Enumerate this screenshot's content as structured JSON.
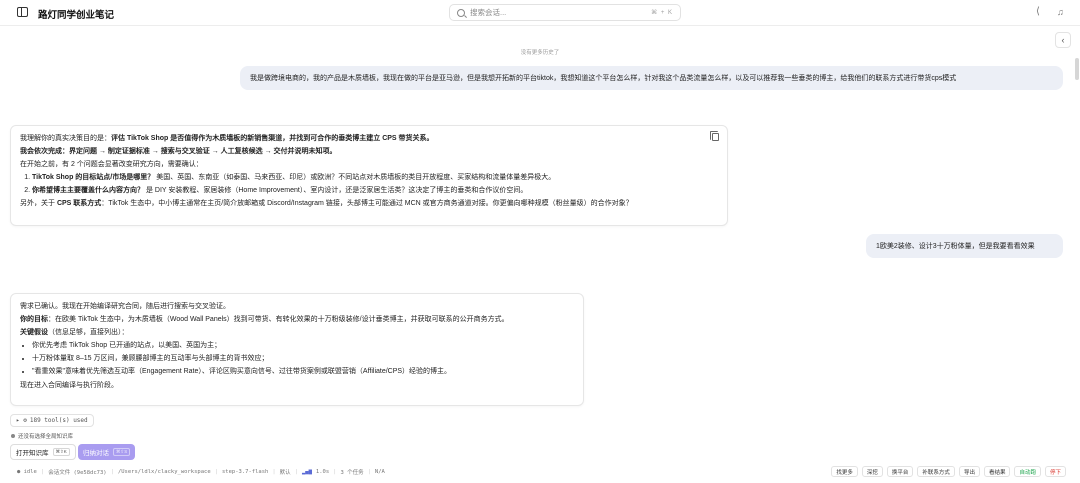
{
  "header": {
    "app_title": "路灯同学创业笔记",
    "search_placeholder": "搜索会话...",
    "search_shortcut": "⌘ + K"
  },
  "thread": {
    "no_history": "没有更多历史了",
    "msg1_user": "我是做跨境电商的，我的产品是木质墙板，我现在做的平台是亚马逊，但是我想开拓新的平台tiktok，我想知道这个平台怎么样，针对我这个品类流量怎么样，以及可以推荐我一些垂类的博主，给我他们的联系方式进行带货cps模式",
    "ai1": {
      "l1_a": "我理解你的真实决策目的是：",
      "l1_b": "评估 TikTok Shop 是否值得作为木质墙板的新销售渠道，并找到可合作的垂类博主建立 CPS 带货关系。",
      "l2_a": "我会依次完成：",
      "l2_b": "界定问题 → 制定证据标准 → 搜索与交叉验证 → 人工复核候选 → 交付并说明未知项。",
      "l3": "在开始之前，有 2 个问题会显著改变研究方向，需要确认：",
      "q1_b": "TikTok Shop 的目标站点/市场是哪里？",
      "q1_t": " 美国、英国、东南亚（如泰国、马来西亚、印尼）或欧洲？不同站点对木质墙板的类目开放程度、买家结构和流量体量差异极大。",
      "q2_b": "你希望博主主要覆盖什么内容方向？",
      "q2_t": " 是 DIY 安装教程、家居装修（Home Improvement）、室内设计，还是泛家居生活类？这决定了博主的垂类和合作议价空间。",
      "l4_a": "另外，关于 ",
      "l4_b": "CPS 联系方式",
      "l4_c": "：TikTok 生态中，中小博主通常在主页/简介放邮箱或 Discord/Instagram 链接，头部博主可能通过 MCN 或官方商务通道对接。你更偏向哪种规模（粉丝量级）的合作对象？"
    },
    "msg2_user": "1欧美2装修、设计3十万粉体量，但是我要看看效果",
    "ai2": {
      "l1": "需求已确认。我现在开始编译研究合同，随后进行搜索与交叉验证。",
      "l2_b": "你的目标",
      "l2_t": "：在欧美 TikTok 生态中，为木质墙板（Wood Wall Panels）找到可带货、有转化效果的十万粉级装修/设计垂类博主，并获取可联系的公开商务方式。",
      "l3_b": "关键假设",
      "l3_t": "（信息足够，直接列出）：",
      "b1": "你优先考虑 TikTok Shop 已开通的站点，以美国、英国为主；",
      "b2": "十万粉体量取 8–15 万区间，兼顾腰部博主的互动率与头部博主的背书效应；",
      "b3": "\"看重效果\"意味着优先筛选互动率（Engagement Rate）、评论区购买意向信号、过往带货案例或联盟营销（Affiliate/CPS）经验的博主。",
      "l4": "现在进入合同编译与执行阶段。"
    },
    "tools_used": "189 tool(s) used",
    "tools_caret": "▸ ⚙"
  },
  "composer": {
    "kb_note": "还没有选择全局知识库",
    "open_kb": "打开知识库",
    "open_kb_kbd": "⌘⇧K",
    "summary": "归纳对话",
    "summary_kbd": "⌘⇧S"
  },
  "status": {
    "idle": "● idle",
    "session_file": "会话文件 (9e58dc73)",
    "path": "/Users/ldlx/clacky_workspace",
    "model": "step-3.7-flash",
    "mode": "默认",
    "speed": "1.0s",
    "tasks": "3 个任务",
    "na": "N/A"
  },
  "actions": [
    "找更多",
    "深挖",
    "换平台",
    "补联系方式",
    "导出",
    "看结果",
    "自动跑",
    "停下"
  ],
  "colors": {
    "accent": "#a99cf0",
    "user_bubble": "#eceff6",
    "auto_run": "#1aa34a",
    "stop": "#d9342b"
  }
}
